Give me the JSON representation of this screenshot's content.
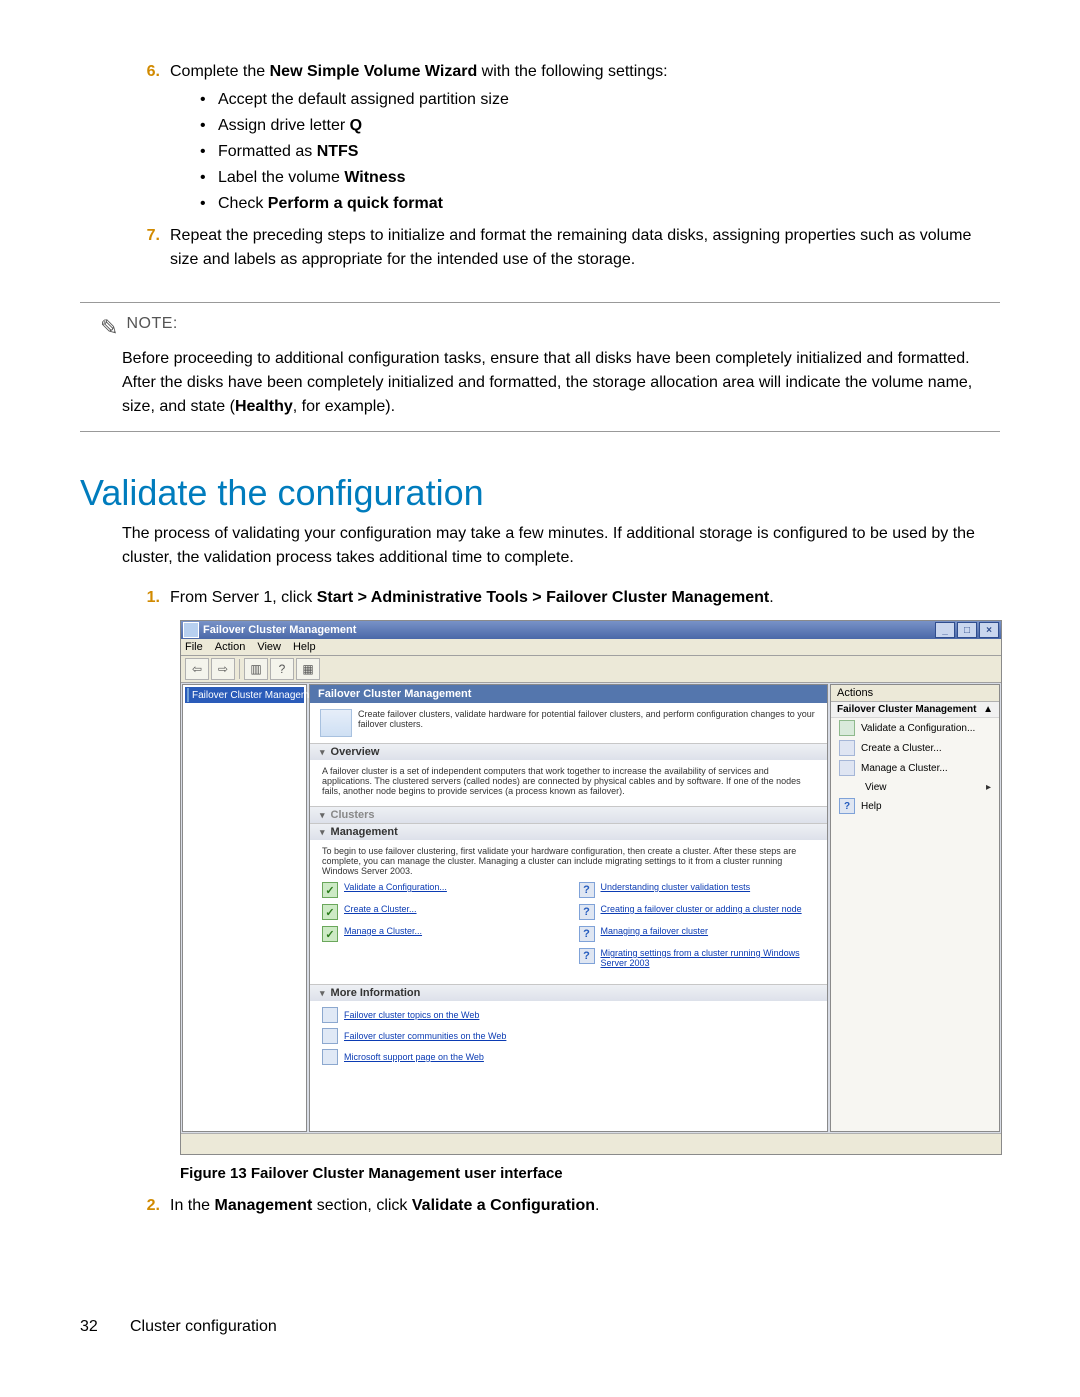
{
  "step6": {
    "num": "6.",
    "text_pre": "Complete the ",
    "bold1": "New Simple Volume Wizard",
    "text_post": " with the following settings:",
    "bullets": [
      {
        "text": "Accept the default assigned partition size"
      },
      {
        "pre": "Assign drive letter ",
        "b": "Q"
      },
      {
        "pre": "Formatted as ",
        "b": "NTFS"
      },
      {
        "pre": "Label the volume ",
        "b": "Witness"
      },
      {
        "pre": "Check ",
        "b": "Perform a quick format"
      }
    ]
  },
  "step7": {
    "num": "7.",
    "text": "Repeat the preceding steps to initialize and format the remaining data disks, assigning properties such as volume size and labels as appropriate for the intended use of the storage."
  },
  "note": {
    "label": "NOTE:",
    "body_pre": "Before proceeding to additional configuration tasks, ensure that all disks have been completely initialized and formatted. After the disks have been completely initialized and formatted, the storage allocation area will indicate the volume name, size, and state (",
    "body_bold": "Healthy",
    "body_post": ", for example)."
  },
  "heading": "Validate the configuration",
  "intro_para": "The process of validating your configuration may take a few minutes. If additional storage is configured to be used by the cluster, the validation process takes additional time to complete.",
  "step1": {
    "num": "1.",
    "pre": "From Server 1, click ",
    "bold": "Start > Administrative Tools > Failover Cluster Management",
    "post": "."
  },
  "screenshot": {
    "title": "Failover Cluster Management",
    "menubar": [
      "File",
      "Action",
      "View",
      "Help"
    ],
    "tree_root": "Failover Cluster Management",
    "center_title": "Failover Cluster Management",
    "intro_text": "Create failover clusters, validate hardware for potential failover clusters, and perform configuration changes to your failover clusters.",
    "overview_title": "Overview",
    "overview_text": "A failover cluster is a set of independent computers that work together to increase the availability of services and applications. The clustered servers (called nodes) are connected by physical cables and by software. If one of the nodes fails, another node begins to provide services (a process known as failover).",
    "clusters_title": "Clusters",
    "mgmt_title": "Management",
    "mgmt_text": "To begin to use failover clustering, first validate your hardware configuration, then create a cluster. After these steps are complete, you can manage the cluster. Managing a cluster can include migrating settings to it from a cluster running Windows Server 2003.",
    "mgmt_left_links": [
      "Validate a Configuration...",
      "Create a Cluster...",
      "Manage a Cluster..."
    ],
    "mgmt_right_links": [
      "Understanding cluster validation tests",
      "Creating a failover cluster or adding a cluster node",
      "Managing a failover cluster",
      "Migrating settings from a cluster running Windows Server 2003"
    ],
    "more_info_title": "More Information",
    "more_info_links": [
      "Failover cluster topics on the Web",
      "Failover cluster communities on the Web",
      "Microsoft support page on the Web"
    ],
    "actions_title": "Actions",
    "actions_group": "Failover Cluster Management",
    "actions_items": [
      "Validate a Configuration...",
      "Create a Cluster...",
      "Manage a Cluster..."
    ],
    "actions_view": "View",
    "actions_help": "Help"
  },
  "fig_caption": "Figure 13 Failover Cluster Management user interface",
  "step2": {
    "num": "2.",
    "pre": "In the ",
    "b1": "Management",
    "mid": " section, click ",
    "b2": "Validate a Configuration",
    "post": "."
  },
  "footer": {
    "page": "32",
    "section": "Cluster configuration"
  }
}
